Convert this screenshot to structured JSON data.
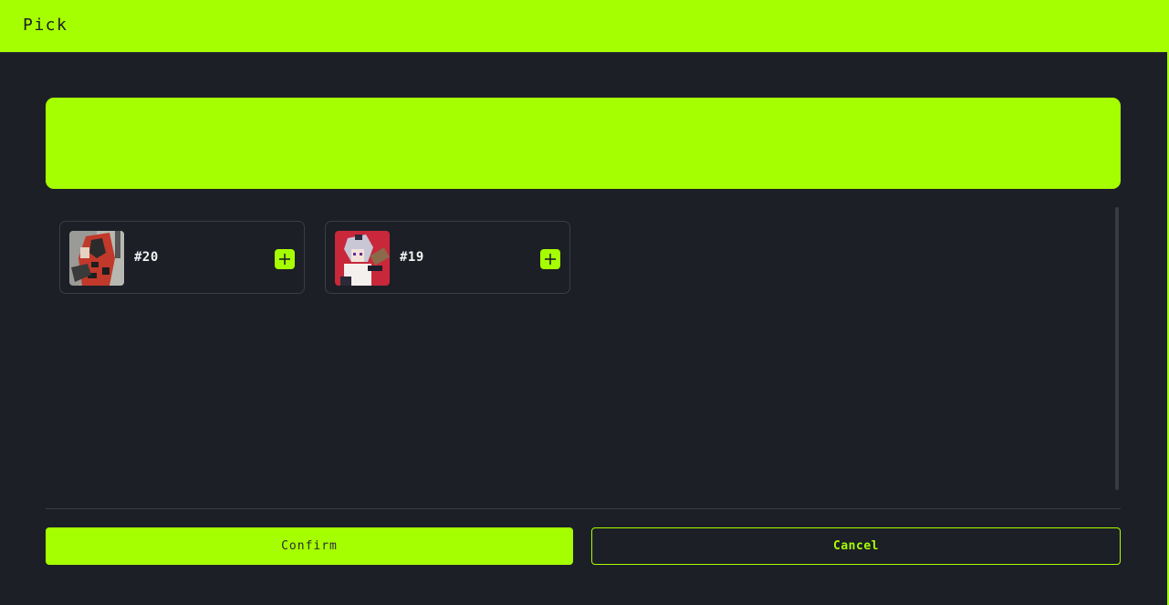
{
  "dialog": {
    "title": "Pick"
  },
  "items": [
    {
      "label": "#20",
      "thumbnail": "nft-avatar-icon"
    },
    {
      "label": "#19",
      "thumbnail": "nft-avatar-icon"
    }
  ],
  "actions": {
    "confirm_label": "Confirm",
    "cancel_label": "Cancel"
  },
  "colors": {
    "accent": "#a6ff00",
    "background": "#1d1f27",
    "card_border": "#3a3d47"
  }
}
